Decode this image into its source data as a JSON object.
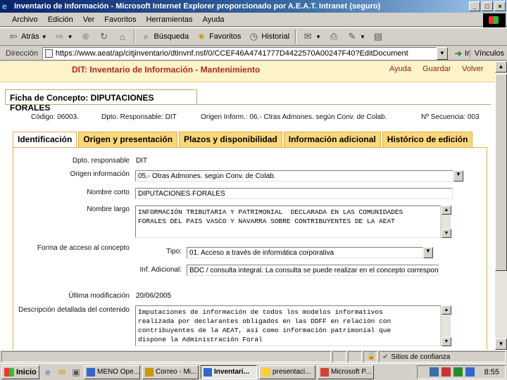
{
  "window": {
    "title": "Inventario de Información - Microsoft Internet Explorer proporcionado por A.E.A.T. Intranet (seguro)"
  },
  "menu": [
    "Archivo",
    "Edición",
    "Ver",
    "Favoritos",
    "Herramientas",
    "Ayuda"
  ],
  "toolbar": {
    "back": "Atrás",
    "search": "Búsqueda",
    "favorites": "Favoritos",
    "history": "Historial"
  },
  "address": {
    "label": "Dirección",
    "url": "https://www.aeat/ap/citjinventario/dtinvnf.nsf/0/CCEF46A4741777D4422570A00247F40?EditDocument",
    "go": "Ir",
    "links": "Vínculos"
  },
  "app": {
    "title": "DIT: Inventario de Información - Mantenimiento",
    "help": "Ayuda",
    "save": "Guardar",
    "back": "Volver"
  },
  "concept": {
    "tab": "Ficha de Concepto: DIPUTACIONES FORALES",
    "codigo": "Código: 06003.",
    "dpto": "Dpto. Responsable: DIT",
    "origen": "Origen Inform.: 06.- Ctras Admones. según Conv. de Colab.",
    "secuencia": "Nº Secuencia: 003"
  },
  "tabs": [
    "Identificación",
    "Origen y presentación",
    "Plazos y disponibilidad",
    "Información adicional",
    "Histórico de edición"
  ],
  "form": {
    "dpto_label": "Dpto. responsable",
    "dpto_value": "DIT",
    "origen_label": "Origen información",
    "origen_value": "05.- Otras Admones. según Conv. de Colab.",
    "nombre_corto_label": "Nombre corto",
    "nombre_corto_value": "DIPUTACIONES FORALES",
    "nombre_largo_label": "Nombre largo",
    "nombre_largo_value": "INFORMACIÓN TRIBUTARIA Y PATRIMONIAL  DECLARADA EN LAS COMUNIDADES\nFORALES DEL PAIS VASCO Y NAVARRA SOBRE CONTRIBUYENTES DE LA AEAT",
    "forma_acceso_label": "Forma de acceso al concepto",
    "tipo_label": "Tipo:",
    "tipo_value": "01. Acceso a través de informática corporativa",
    "inf_adicional_label": "Inf. Adicional:",
    "inf_adicional_value": "BDC / consulta integral. La consulta se puede realizar en el concepto correspondiente",
    "ultima_mod_label": "Última modificación",
    "ultima_mod_value": "20/06/2005",
    "descripcion_label": "Descripción detallada del contenido",
    "descripcion_value": "Imputaciones de información de todos los modelos informativos\nrealizada por declarantes obligados en las DDFF en relación con\ncontribuyentes de la AEAT, así como información patrimonial que\ndispone la Administración Foral"
  },
  "status": {
    "zone": "Sitios de confianza"
  },
  "taskbar": {
    "start": "Inicio",
    "tasks": [
      "MENO Ope...",
      "Correo - Mi...",
      "Inventari...",
      "presentaci...",
      "Microsoft P..."
    ],
    "clock": "8:55"
  }
}
